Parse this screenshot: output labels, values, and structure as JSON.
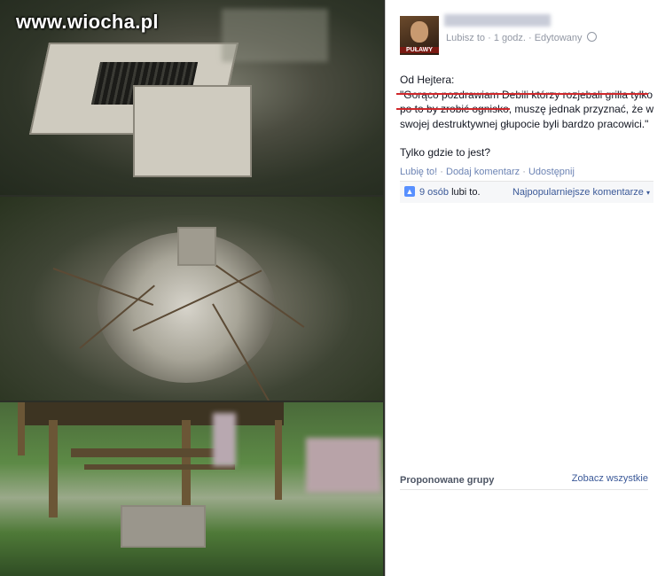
{
  "watermark": "www.wiocha.pl",
  "post": {
    "avatar_label": "PUŁAWY",
    "meta_like": "Lubisz to",
    "meta_time": "1 godz.",
    "meta_edited": "Edytowany",
    "line_intro": "Od Hejtera:",
    "quote": "\"Gorąco pozdrawiam Debili którzy rozjebali grilla tylko po to by zrobić ognisko, muszę jednak przyznać, że w swojej destruktywnej głupocie byli bardzo pracowici.\"",
    "question": "Tylko gdzie to jest?",
    "actions": {
      "like": "Lubię to!",
      "comment": "Dodaj komentarz",
      "share": "Udostępnij"
    },
    "likes": {
      "count": "9 osób",
      "suffix": " lubi to.",
      "popular": "Najpopularniejsze komentarze"
    }
  },
  "sidebar": {
    "groups_title": "Proponowane grupy",
    "see_all": "Zobacz wszystkie"
  },
  "colors": {
    "link": "#3b5998",
    "underline": "#d0282c",
    "text": "#141823"
  }
}
